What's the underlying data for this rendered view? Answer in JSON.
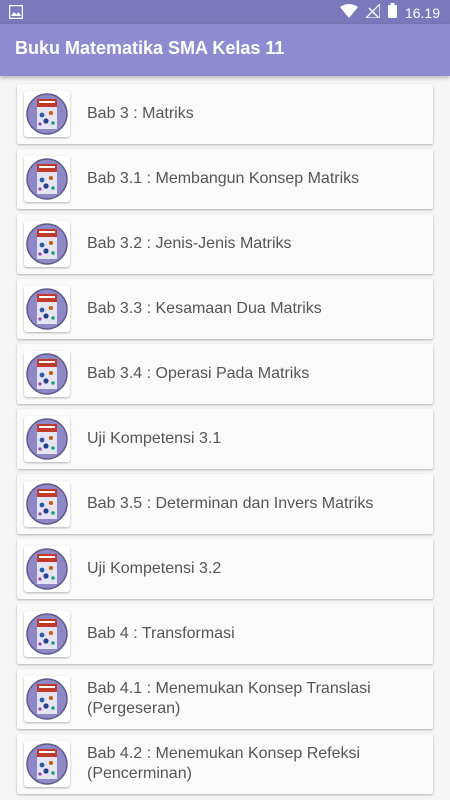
{
  "status_bar": {
    "time": "16.19",
    "icons": [
      "image-icon",
      "wifi-icon",
      "no-signal-icon",
      "battery-icon"
    ]
  },
  "app_bar": {
    "title": "Buku Matematika SMA Kelas 11"
  },
  "colors": {
    "status_bar": "#7b78bb",
    "app_bar": "#8e8bd0",
    "list_background": "#f5f5f5",
    "card_background": "#fafafa",
    "item_text": "#555555"
  },
  "items": [
    {
      "label": "Bab 3 : Matriks",
      "icon": "book-cover-icon"
    },
    {
      "label": "Bab 3.1 : Membangun Konsep Matriks",
      "icon": "book-cover-icon"
    },
    {
      "label": "Bab 3.2 : Jenis-Jenis Matriks",
      "icon": "book-cover-icon"
    },
    {
      "label": "Bab 3.3 : Kesamaan Dua Matriks",
      "icon": "book-cover-icon"
    },
    {
      "label": "Bab 3.4 : Operasi Pada Matriks",
      "icon": "book-cover-icon"
    },
    {
      "label": "Uji Kompetensi 3.1",
      "icon": "book-cover-icon"
    },
    {
      "label": "Bab 3.5 : Determinan dan Invers Matriks",
      "icon": "book-cover-icon"
    },
    {
      "label": "Uji Kompetensi 3.2",
      "icon": "book-cover-icon"
    },
    {
      "label": "Bab 4 : Transformasi",
      "icon": "book-cover-icon"
    },
    {
      "label": "Bab 4.1 : Menemukan Konsep Translasi (Pergeseran)",
      "icon": "book-cover-icon"
    },
    {
      "label": "Bab 4.2 : Menemukan Konsep Refeksi (Pencerminan)",
      "icon": "book-cover-icon"
    }
  ]
}
